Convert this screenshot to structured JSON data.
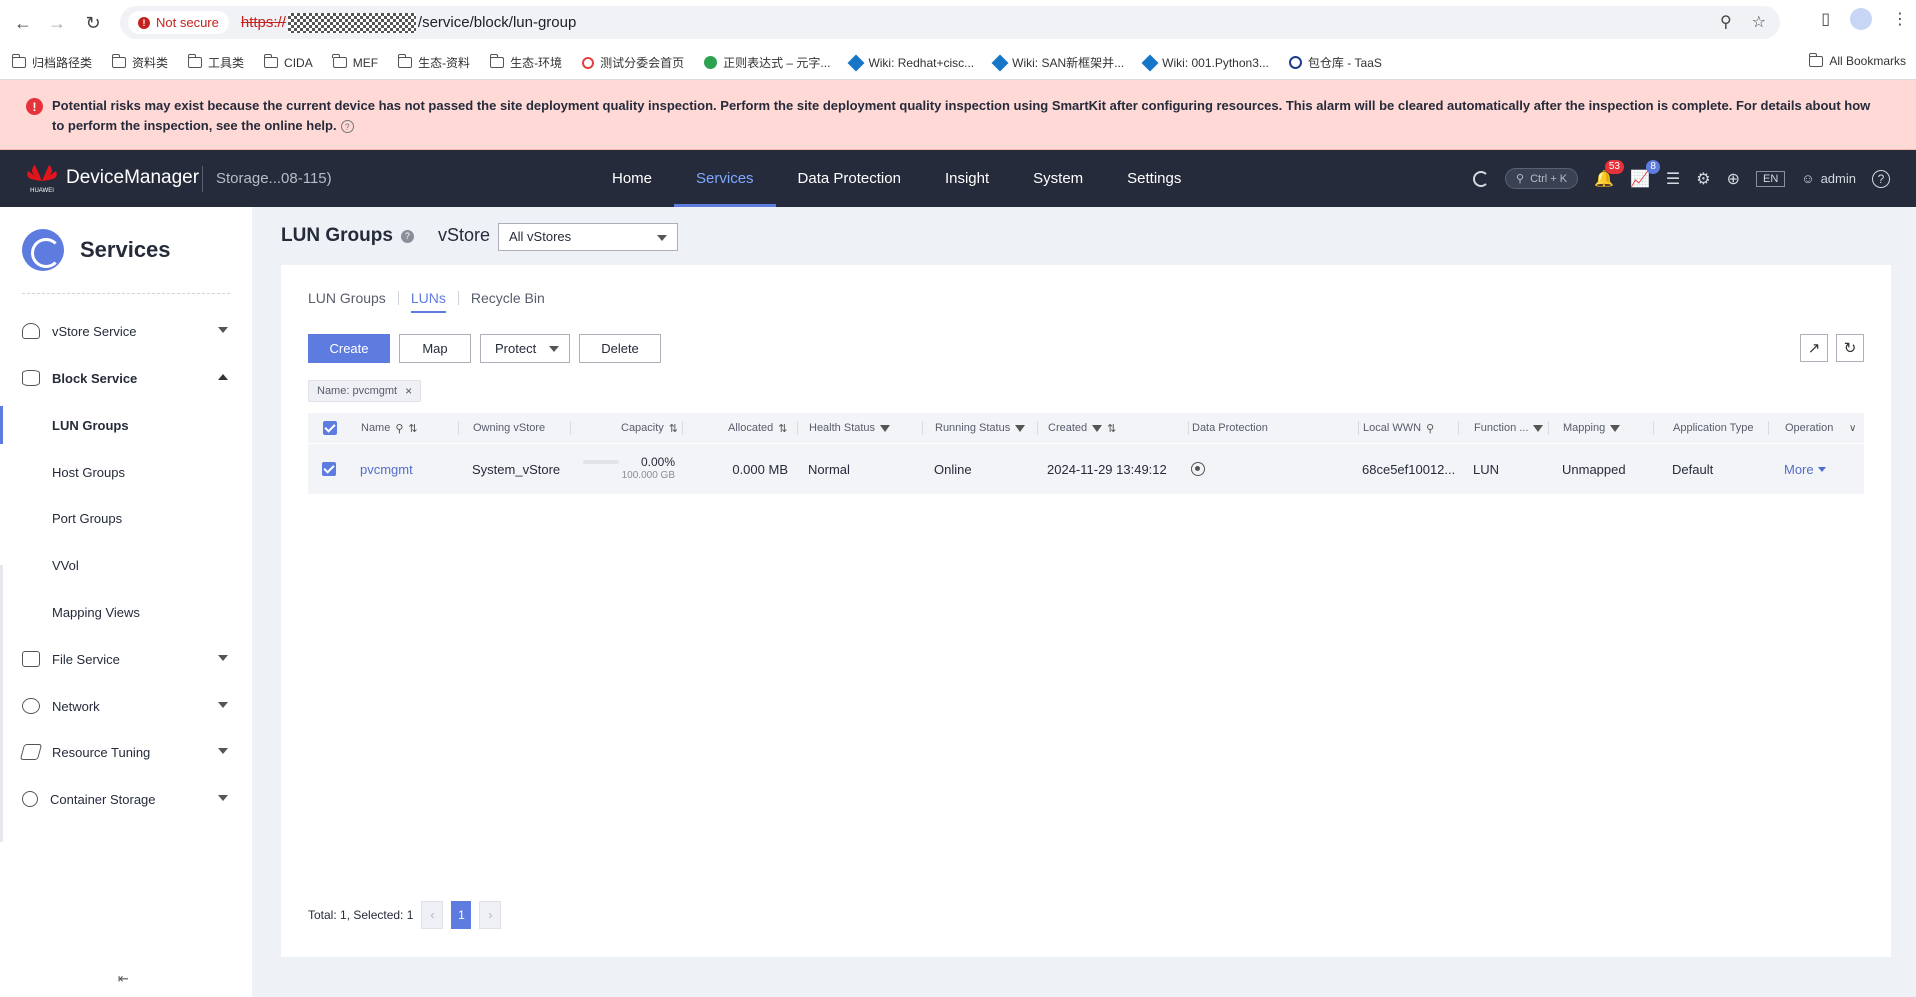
{
  "browser": {
    "not_secure": "Not secure",
    "url_scheme": "https://",
    "url_path": "/service/block/lun-group",
    "bookmarks": [
      "归档路径类",
      "资料类",
      "工具类",
      "CIDA",
      "MEF",
      "生态-资料",
      "生态-环境",
      "测试分委会首页",
      "正则表达式 – 元字...",
      "Wiki: Redhat+cisc...",
      "Wiki: SAN新框架并...",
      "Wiki: 001.Python3...",
      "包仓库 - TaaS"
    ],
    "all_bookmarks": "All Bookmarks"
  },
  "alert": {
    "text": "Potential risks may exist because the current device has not passed the site deployment quality inspection. Perform the site deployment quality inspection using SmartKit after configuring resources. This alarm will be cleared automatically after the inspection is complete. For details about how to perform the inspection, see the online help."
  },
  "header": {
    "logo_text": "HUAWEI",
    "brand": "DeviceManager",
    "device": "Storage...08-115)",
    "nav": [
      "Home",
      "Services",
      "Data Protection",
      "Insight",
      "System",
      "Settings"
    ],
    "active_nav": "Services",
    "search_hint": "Ctrl + K",
    "alarm_count": "53",
    "task_count": "8",
    "lang": "EN",
    "user": "admin"
  },
  "sidebar": {
    "title": "Services",
    "items": [
      {
        "label": "vStore Service",
        "icon": "user-icon"
      },
      {
        "label": "Block Service",
        "icon": "database-icon"
      },
      {
        "label": "File Service",
        "icon": "folder-icon"
      },
      {
        "label": "Network",
        "icon": "globe-icon"
      },
      {
        "label": "Resource Tuning",
        "icon": "layers-icon"
      },
      {
        "label": "Container Storage",
        "icon": "cubes-icon"
      }
    ],
    "block_sub": [
      "LUN Groups",
      "Host Groups",
      "Port Groups",
      "VVol",
      "Mapping Views"
    ],
    "active_sub": "LUN Groups"
  },
  "main": {
    "title": "LUN Groups",
    "vstore_label": "vStore",
    "vstore_value": "All vStores",
    "tabs": [
      "LUN Groups",
      "LUNs",
      "Recycle Bin"
    ],
    "active_tab": "LUNs",
    "buttons": {
      "create": "Create",
      "map": "Map",
      "protect": "Protect",
      "delete": "Delete"
    },
    "filter_chip": "Name: pvcmgmt",
    "columns": [
      "Name",
      "Owning vStore",
      "Capacity",
      "Allocated",
      "Health Status",
      "Running Status",
      "Created",
      "Data Protection",
      "Local WWN",
      "Function ...",
      "Mapping",
      "Application Type",
      "Operation"
    ],
    "rows": [
      {
        "name": "pvcmgmt",
        "owning_vstore": "System_vStore",
        "capacity_pct": "0.00%",
        "capacity_fraction": 0.0,
        "capacity_total": "100.000 GB",
        "allocated": "0.000 MB",
        "health": "Normal",
        "running": "Online",
        "created": "2024-11-29 13:49:12",
        "local_wwn": "68ce5ef10012...",
        "function": "LUN",
        "mapping": "Unmapped",
        "app_type": "Default",
        "operation": "More"
      }
    ],
    "pagination": {
      "summary": "Total: 1, Selected: 1",
      "page": "1"
    }
  },
  "colors": {
    "accent": "#5e7ce0",
    "header_bg": "#252b3a",
    "alert_bg": "#ffd9d6",
    "alert_icon": "#e6323b"
  }
}
